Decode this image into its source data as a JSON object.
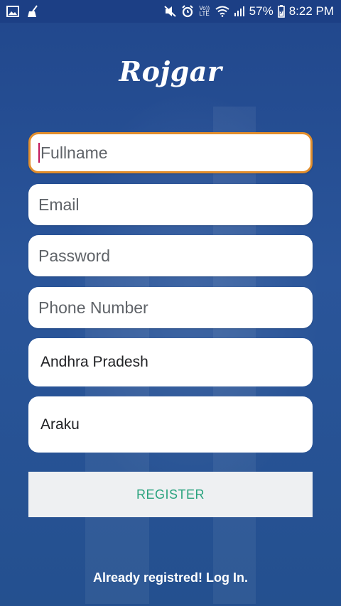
{
  "status_bar": {
    "battery": "57%",
    "time": "8:22 PM",
    "network_badge": "Vo)) LTE",
    "left_icons": [
      "image-icon",
      "broom-icon"
    ],
    "right_icons": [
      "mute-icon",
      "alarm-icon",
      "wifi-icon",
      "signal-icon",
      "battery-icon"
    ]
  },
  "app": {
    "logo_text": "Rojgar"
  },
  "form": {
    "fullname_placeholder": "Fullname",
    "email_placeholder": "Email",
    "password_placeholder": "Password",
    "phone_placeholder": "Phone Number",
    "state_value": "Andhra Pradesh",
    "city_value": "Araku",
    "register_label": "REGISTER"
  },
  "footer": {
    "login_link": "Already registred! Log In."
  },
  "colors": {
    "background": "#254f95",
    "status_bar": "#1c3f85",
    "focus_border": "#e28e2c",
    "register_text": "#2aa37e",
    "button_bg": "#eef0f2"
  }
}
